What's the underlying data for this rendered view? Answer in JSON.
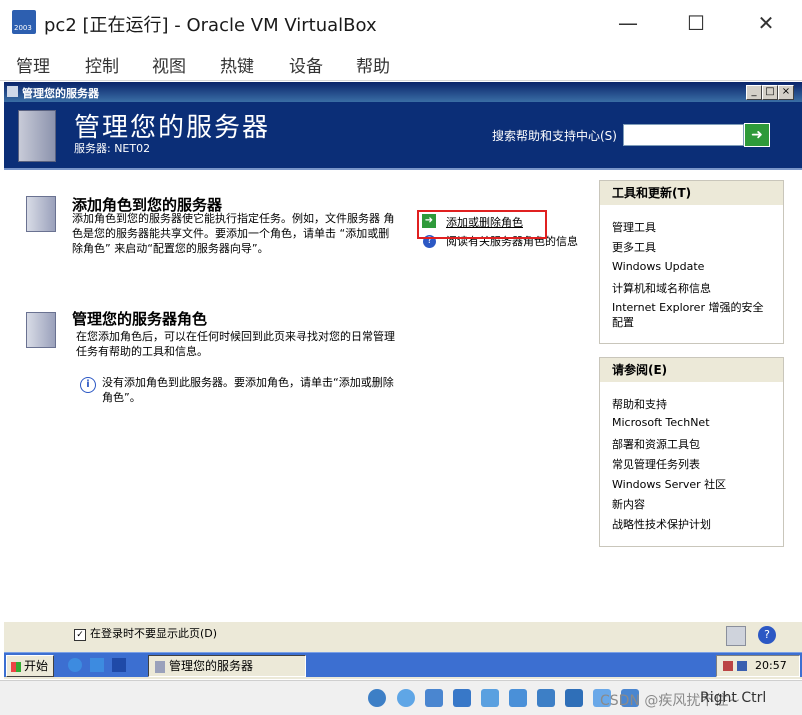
{
  "host": {
    "title": "pc2 [正在运行] - Oracle VM VirtualBox",
    "logo_text": "2003",
    "menu": [
      "管理",
      "控制",
      "视图",
      "热键",
      "设备",
      "帮助"
    ],
    "status_text": "CSDN @疾风扰不住~",
    "host_key": "Right Ctrl"
  },
  "window": {
    "title": "管理您的服务器",
    "banner_title": "管理您的服务器",
    "server_label": "服务器: NET02",
    "search_label": "搜索帮助和支持中心(S)",
    "search_value": ""
  },
  "sections": {
    "add_role": {
      "title": "添加角色到您的服务器",
      "desc": "添加角色到您的服务器使它能执行指定任务。例如，文件服务器 角色是您的服务器能共享文件。要添加一个角色，请单击 “添加或删除角色” 来启动“配置您的服务器向导”。",
      "link_add": "添加或删除角色",
      "link_read": "阅读有关服务器角色的信息"
    },
    "manage_roles": {
      "title": "管理您的服务器角色",
      "desc": "在您添加角色后，可以在任何时候回到此页来寻找对您的日常管理任务有帮助的工具和信息。",
      "info": "没有添加角色到此服务器。要添加角色，请单击“添加或删除角色”。"
    },
    "dont_show": "在登录时不要显示此页(D)",
    "dont_show_checked": true
  },
  "panels": {
    "tools": {
      "title": "工具和更新(T)",
      "items": [
        "管理工具",
        "更多工具",
        "Windows Update",
        "计算机和域名称信息",
        "Internet Explorer 增强的安全配置"
      ]
    },
    "see_also": {
      "title": "请参阅(E)",
      "items": [
        "帮助和支持",
        "Microsoft TechNet",
        "部署和资源工具包",
        "常见管理任务列表",
        "Windows Server 社区",
        "新内容",
        "战略性技术保护计划"
      ]
    }
  },
  "taskbar": {
    "start": "开始",
    "item": "管理您的服务器",
    "clock": "20:57"
  },
  "colors": {
    "banner": "#0b2e77",
    "taskbar": "#3c6fd1",
    "highlight": "#e02020"
  }
}
